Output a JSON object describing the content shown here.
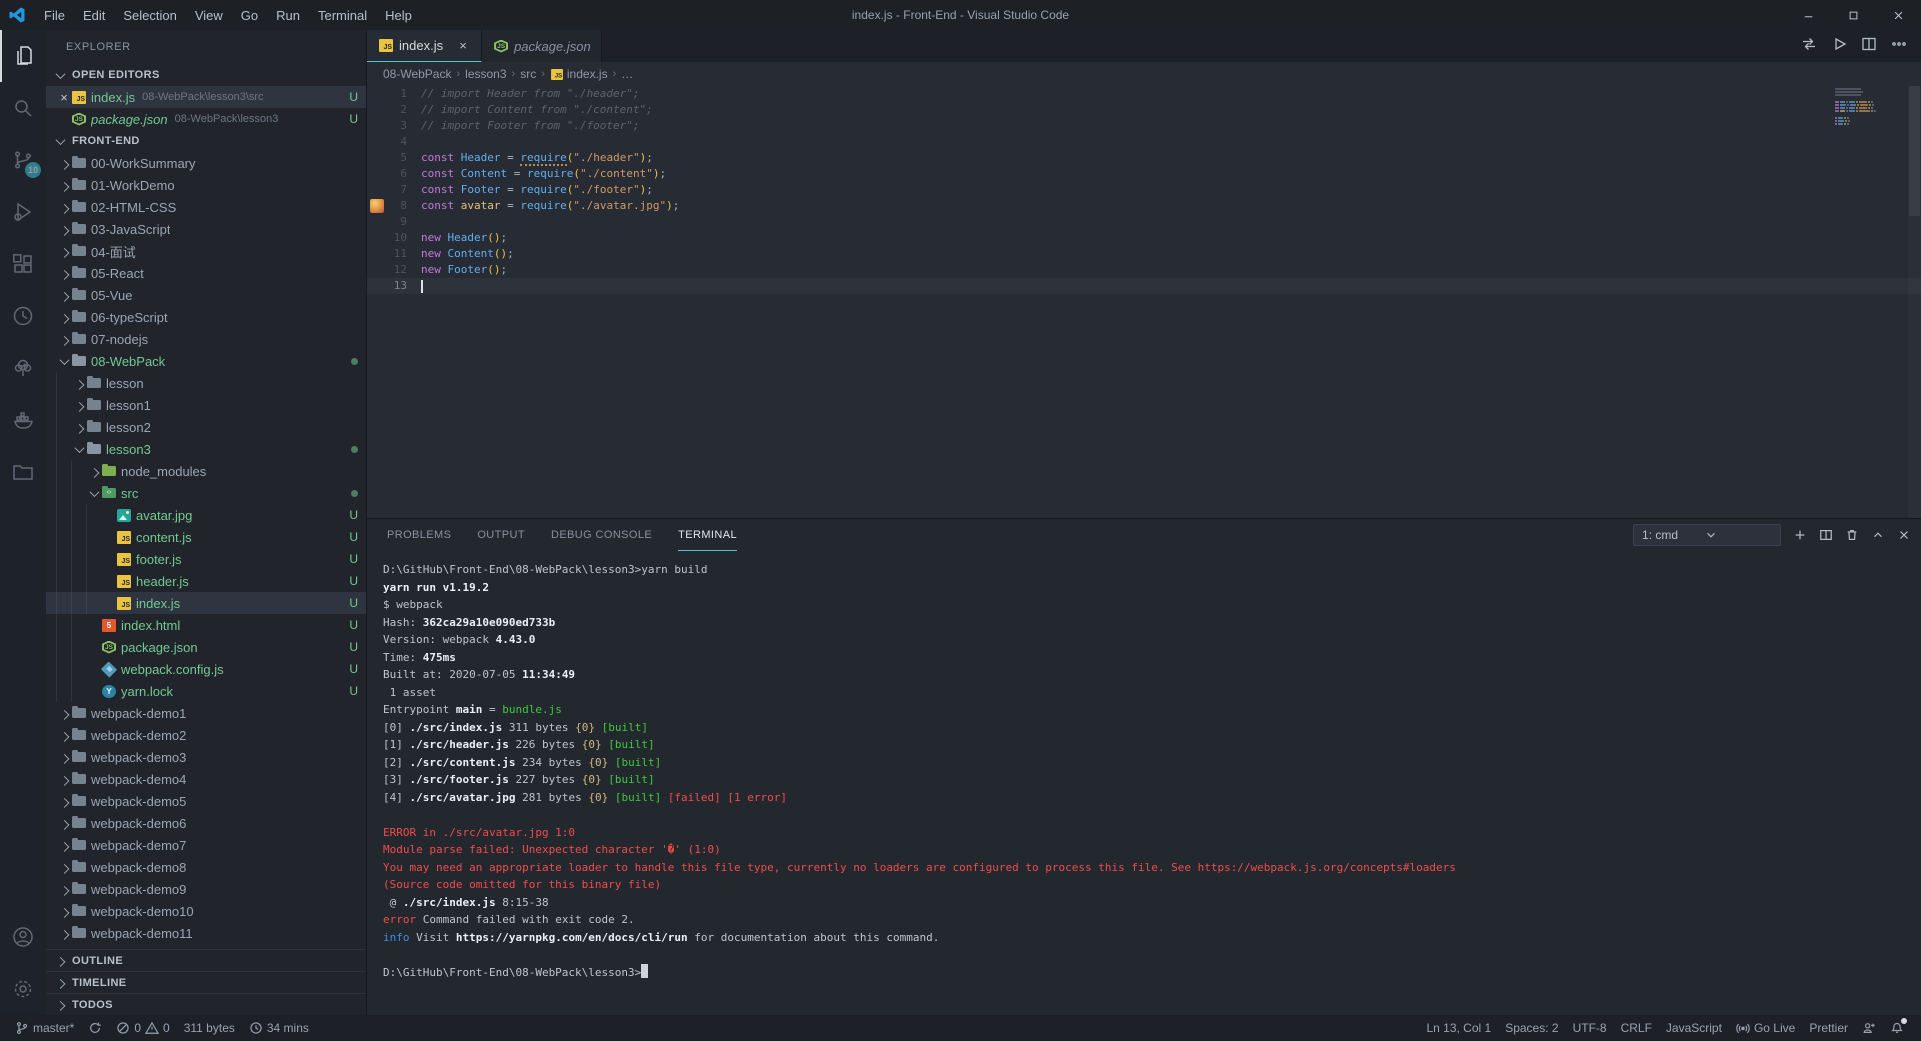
{
  "colors": {
    "accent_cyan": "#4ec9d4",
    "untracked_green": "#73c991",
    "badge_cyan": "#3ec8da",
    "error_red": "#f14c4c",
    "terminal_green": "#3fc93f",
    "info_blue": "#3b8eea",
    "js_yellow": "#e8c441",
    "keyword_purple": "#c678dd",
    "string_orange": "#d19a66"
  },
  "window": {
    "title": "index.js - Front-End - Visual Studio Code",
    "menus": [
      "File",
      "Edit",
      "Selection",
      "View",
      "Go",
      "Run",
      "Terminal",
      "Help"
    ],
    "controls": [
      "minimize",
      "maximize",
      "close"
    ]
  },
  "activity_bar": {
    "top": [
      {
        "name": "explorer",
        "active": true
      },
      {
        "name": "search"
      },
      {
        "name": "source-control",
        "badge": "10"
      },
      {
        "name": "run-debug"
      },
      {
        "name": "extensions"
      },
      {
        "name": "gitlens"
      },
      {
        "name": "todo-tree"
      },
      {
        "name": "docker"
      },
      {
        "name": "project-manager"
      }
    ],
    "bottom": [
      {
        "name": "account"
      },
      {
        "name": "settings"
      }
    ]
  },
  "sidebar": {
    "title": "EXPLORER",
    "open_editors": {
      "label": "OPEN EDITORS",
      "items": [
        {
          "name": "index.js",
          "path": "08-WebPack\\lesson3\\src",
          "icon": "js",
          "badge": "U",
          "selected": true,
          "close": true
        },
        {
          "name": "package.json",
          "path": "08-WebPack\\lesson3",
          "icon": "npm",
          "badge": "U",
          "italic": true
        }
      ]
    },
    "section_label": "FRONT-END",
    "tree": [
      {
        "label": "00-WorkSummary",
        "depth": 1,
        "chev": "right",
        "icon": "folder"
      },
      {
        "label": "01-WorkDemo",
        "depth": 1,
        "chev": "right",
        "icon": "folder"
      },
      {
        "label": "02-HTML-CSS",
        "depth": 1,
        "chev": "right",
        "icon": "folder"
      },
      {
        "label": "03-JavaScript",
        "depth": 1,
        "chev": "right",
        "icon": "folder"
      },
      {
        "label": "04-面试",
        "depth": 1,
        "chev": "right",
        "icon": "folder"
      },
      {
        "label": "05-React",
        "depth": 1,
        "chev": "right",
        "icon": "folder"
      },
      {
        "label": "05-Vue",
        "depth": 1,
        "chev": "right",
        "icon": "folder"
      },
      {
        "label": "06-typeScript",
        "depth": 1,
        "chev": "right",
        "icon": "folder"
      },
      {
        "label": "07-nodejs",
        "depth": 1,
        "chev": "right",
        "icon": "folder"
      },
      {
        "label": "08-WebPack",
        "depth": 1,
        "chev": "down",
        "icon": "folder-open",
        "green": true,
        "dot": true
      },
      {
        "label": "lesson",
        "depth": 2,
        "chev": "right",
        "icon": "folder"
      },
      {
        "label": "lesson1",
        "depth": 2,
        "chev": "right",
        "icon": "folder"
      },
      {
        "label": "lesson2",
        "depth": 2,
        "chev": "right",
        "icon": "folder"
      },
      {
        "label": "lesson3",
        "depth": 2,
        "chev": "down",
        "icon": "folder-open",
        "green": true,
        "dot": true
      },
      {
        "label": "node_modules",
        "depth": 3,
        "chev": "right",
        "icon": "folder-node"
      },
      {
        "label": "src",
        "depth": 3,
        "chev": "down",
        "icon": "folder-src",
        "green": true,
        "dot": true
      },
      {
        "label": "avatar.jpg",
        "depth": 4,
        "icon": "image",
        "green": true,
        "badge": "U"
      },
      {
        "label": "content.js",
        "depth": 4,
        "icon": "js",
        "green": true,
        "badge": "U"
      },
      {
        "label": "footer.js",
        "depth": 4,
        "icon": "js",
        "green": true,
        "badge": "U"
      },
      {
        "label": "header.js",
        "depth": 4,
        "icon": "js",
        "green": true,
        "badge": "U"
      },
      {
        "label": "index.js",
        "depth": 4,
        "icon": "js",
        "green": true,
        "badge": "U",
        "selected": true
      },
      {
        "label": "index.html",
        "depth": 3,
        "icon": "html",
        "green": true,
        "badge": "U"
      },
      {
        "label": "package.json",
        "depth": 3,
        "icon": "npm",
        "green": true,
        "badge": "U"
      },
      {
        "label": "webpack.config.js",
        "depth": 3,
        "icon": "webpack",
        "green": true,
        "badge": "U"
      },
      {
        "label": "yarn.lock",
        "depth": 3,
        "icon": "yarn",
        "green": true,
        "badge": "U"
      },
      {
        "label": "webpack-demo1",
        "depth": 1,
        "chev": "right",
        "icon": "folder"
      },
      {
        "label": "webpack-demo2",
        "depth": 1,
        "chev": "right",
        "icon": "folder"
      },
      {
        "label": "webpack-demo3",
        "depth": 1,
        "chev": "right",
        "icon": "folder"
      },
      {
        "label": "webpack-demo4",
        "depth": 1,
        "chev": "right",
        "icon": "folder"
      },
      {
        "label": "webpack-demo5",
        "depth": 1,
        "chev": "right",
        "icon": "folder"
      },
      {
        "label": "webpack-demo6",
        "depth": 1,
        "chev": "right",
        "icon": "folder"
      },
      {
        "label": "webpack-demo7",
        "depth": 1,
        "chev": "right",
        "icon": "folder"
      },
      {
        "label": "webpack-demo8",
        "depth": 1,
        "chev": "right",
        "icon": "folder"
      },
      {
        "label": "webpack-demo9",
        "depth": 1,
        "chev": "right",
        "icon": "folder"
      },
      {
        "label": "webpack-demo10",
        "depth": 1,
        "chev": "right",
        "icon": "folder"
      },
      {
        "label": "webpack-demo11",
        "depth": 1,
        "chev": "right",
        "icon": "folder"
      }
    ],
    "bottom_sections": [
      "OUTLINE",
      "TIMELINE",
      "TODOS"
    ]
  },
  "editor": {
    "tabs": [
      {
        "label": "index.js",
        "icon": "js",
        "active": true,
        "close": "×"
      },
      {
        "label": "package.json",
        "icon": "npm",
        "italic": true
      }
    ],
    "actions": [
      "open-changes",
      "run",
      "split-editor",
      "more-actions"
    ],
    "breadcrumb": {
      "items": [
        "08-WebPack",
        "lesson3",
        "src",
        "index.js",
        "…"
      ],
      "file_icon_index": 3
    },
    "code_lines": [
      {
        "n": 1,
        "tokens": [
          [
            "cm",
            "// import Header from \"./header\";"
          ]
        ]
      },
      {
        "n": 2,
        "tokens": [
          [
            "cm",
            "// import Content from \"./content\";"
          ]
        ]
      },
      {
        "n": 3,
        "tokens": [
          [
            "cm",
            "// import Footer from \"./footer\";"
          ]
        ]
      },
      {
        "n": 4,
        "tokens": []
      },
      {
        "n": 5,
        "tokens": [
          [
            "kw",
            "const"
          ],
          [
            "pl",
            " "
          ],
          [
            "vb",
            "Header"
          ],
          [
            "pl",
            " = "
          ],
          [
            "fnu",
            "require"
          ],
          [
            "pa",
            "("
          ],
          [
            "st",
            "\"./header\""
          ],
          [
            "pa",
            ")"
          ],
          [
            "pl",
            ";"
          ]
        ]
      },
      {
        "n": 6,
        "tokens": [
          [
            "kw",
            "const"
          ],
          [
            "pl",
            " "
          ],
          [
            "vb",
            "Content"
          ],
          [
            "pl",
            " = "
          ],
          [
            "fn",
            "require"
          ],
          [
            "pa",
            "("
          ],
          [
            "st",
            "\"./content\""
          ],
          [
            "pa",
            ")"
          ],
          [
            "pl",
            ";"
          ]
        ]
      },
      {
        "n": 7,
        "tokens": [
          [
            "kw",
            "const"
          ],
          [
            "pl",
            " "
          ],
          [
            "vb",
            "Footer"
          ],
          [
            "pl",
            " = "
          ],
          [
            "fn",
            "require"
          ],
          [
            "pa",
            "("
          ],
          [
            "st",
            "\"./footer\""
          ],
          [
            "pa",
            ")"
          ],
          [
            "pl",
            ";"
          ]
        ]
      },
      {
        "n": 8,
        "glyph": "avatar-thumbnail",
        "tokens": [
          [
            "kw",
            "const"
          ],
          [
            "pl",
            " "
          ],
          [
            "vy",
            "avatar"
          ],
          [
            "pl",
            " = "
          ],
          [
            "fn",
            "require"
          ],
          [
            "pa",
            "("
          ],
          [
            "st",
            "\"./avatar.jpg\""
          ],
          [
            "pa",
            ")"
          ],
          [
            "pl",
            ";"
          ]
        ]
      },
      {
        "n": 9,
        "tokens": []
      },
      {
        "n": 10,
        "tokens": [
          [
            "kw",
            "new"
          ],
          [
            "pl",
            " "
          ],
          [
            "vb",
            "Header"
          ],
          [
            "pa",
            "()"
          ],
          [
            "pl",
            ";"
          ]
        ]
      },
      {
        "n": 11,
        "tokens": [
          [
            "kw",
            "new"
          ],
          [
            "pl",
            " "
          ],
          [
            "vb",
            "Content"
          ],
          [
            "pa",
            "()"
          ],
          [
            "pl",
            ";"
          ]
        ]
      },
      {
        "n": 12,
        "tokens": [
          [
            "kw",
            "new"
          ],
          [
            "pl",
            " "
          ],
          [
            "vb",
            "Footer"
          ],
          [
            "pa",
            "()"
          ],
          [
            "pl",
            ";"
          ]
        ]
      },
      {
        "n": 13,
        "tokens": [],
        "cursor": true
      }
    ]
  },
  "panel": {
    "tabs": [
      "PROBLEMS",
      "OUTPUT",
      "DEBUG CONSOLE",
      "TERMINAL"
    ],
    "active_tab": "TERMINAL",
    "shell_selector": "1: cmd",
    "controls": [
      "new-terminal",
      "split-terminal",
      "kill-terminal",
      "maximize-panel",
      "close-panel"
    ],
    "terminal_lines": [
      [
        [
          "d",
          "D:\\GitHub\\Front-End\\08-WebPack\\lesson3>yarn build"
        ]
      ],
      [
        [
          "b",
          "yarn run v1.19.2"
        ]
      ],
      [
        [
          "d",
          "$ webpack"
        ]
      ],
      [
        [
          "d",
          "Hash: "
        ],
        [
          "b",
          "362ca29a10e090ed733b"
        ]
      ],
      [
        [
          "d",
          "Version: webpack "
        ],
        [
          "b",
          "4.43.0"
        ]
      ],
      [
        [
          "d",
          "Time: "
        ],
        [
          "b",
          "475ms"
        ]
      ],
      [
        [
          "d",
          "Built at: 2020-07-05 "
        ],
        [
          "b",
          "11:34:49"
        ]
      ],
      [
        [
          "d",
          " 1 asset"
        ]
      ],
      [
        [
          "d",
          "Entrypoint "
        ],
        [
          "b",
          "main"
        ],
        [
          "d",
          " = "
        ],
        [
          "g",
          "bundle.js"
        ]
      ],
      [
        [
          "d",
          "[0] "
        ],
        [
          "b",
          "./src/index.js"
        ],
        [
          "d",
          " 311 bytes "
        ],
        [
          "y",
          "{0}"
        ],
        [
          "d",
          " "
        ],
        [
          "g",
          "[built]"
        ]
      ],
      [
        [
          "d",
          "[1] "
        ],
        [
          "b",
          "./src/header.js"
        ],
        [
          "d",
          " 226 bytes "
        ],
        [
          "y",
          "{0}"
        ],
        [
          "d",
          " "
        ],
        [
          "g",
          "[built]"
        ]
      ],
      [
        [
          "d",
          "[2] "
        ],
        [
          "b",
          "./src/content.js"
        ],
        [
          "d",
          " 234 bytes "
        ],
        [
          "y",
          "{0}"
        ],
        [
          "d",
          " "
        ],
        [
          "g",
          "[built]"
        ]
      ],
      [
        [
          "d",
          "[3] "
        ],
        [
          "b",
          "./src/footer.js"
        ],
        [
          "d",
          " 227 bytes "
        ],
        [
          "y",
          "{0}"
        ],
        [
          "d",
          " "
        ],
        [
          "g",
          "[built]"
        ]
      ],
      [
        [
          "d",
          "[4] "
        ],
        [
          "b",
          "./src/avatar.jpg"
        ],
        [
          "d",
          " 281 bytes "
        ],
        [
          "y",
          "{0}"
        ],
        [
          "d",
          " "
        ],
        [
          "g",
          "[built]"
        ],
        [
          "d",
          " "
        ],
        [
          "r",
          "[failed]"
        ],
        [
          "d",
          " "
        ],
        [
          "r",
          "[1 error]"
        ]
      ],
      [],
      [
        [
          "r",
          "ERROR in ./src/avatar.jpg 1:0"
        ]
      ],
      [
        [
          "r",
          "Module parse failed: Unexpected character '�' (1:0)"
        ]
      ],
      [
        [
          "r",
          "You may need an appropriate loader to handle this file type, currently no loaders are configured to process this file. See https://webpack.js.org/concepts#loaders"
        ]
      ],
      [
        [
          "r",
          "(Source code omitted for this binary file)"
        ]
      ],
      [
        [
          "d",
          " @ "
        ],
        [
          "b",
          "./src/index.js"
        ],
        [
          "d",
          " 8:15-38"
        ]
      ],
      [
        [
          "r",
          "error"
        ],
        [
          "d",
          " Command failed with exit code 2."
        ]
      ],
      [
        [
          "bl",
          "info"
        ],
        [
          "d",
          " Visit "
        ],
        [
          "b",
          "https://yarnpkg.com/en/docs/cli/run"
        ],
        [
          "d",
          " for documentation about this command."
        ]
      ],
      [],
      [
        [
          "d",
          "D:\\GitHub\\Front-End\\08-WebPack\\lesson3>"
        ],
        [
          "cursor",
          ""
        ]
      ]
    ]
  },
  "status_bar": {
    "left": [
      {
        "icon": "git-branch",
        "label": "master*",
        "name": "git-branch-status"
      },
      {
        "icon": "sync",
        "label": "",
        "name": "sync-status"
      },
      {
        "icon": "error",
        "label": "0",
        "icon2": "warning",
        "label2": "0",
        "name": "problems-status"
      },
      {
        "label": "311 bytes",
        "name": "file-size-status"
      },
      {
        "icon": "history",
        "label": "34 mins",
        "name": "timeline-status"
      }
    ],
    "right": [
      {
        "label": "Ln 13, Col 1",
        "name": "cursor-position"
      },
      {
        "label": "Spaces: 2",
        "name": "indentation"
      },
      {
        "label": "UTF-8",
        "name": "encoding"
      },
      {
        "label": "CRLF",
        "name": "eol"
      },
      {
        "label": "JavaScript",
        "name": "language-mode"
      },
      {
        "icon": "broadcast",
        "label": "Go Live",
        "name": "go-live"
      },
      {
        "label": "Prettier",
        "name": "prettier"
      },
      {
        "icon": "feedback",
        "label": "",
        "name": "feedback"
      },
      {
        "icon": "bell",
        "label": "",
        "dot": true,
        "name": "notifications"
      }
    ]
  }
}
